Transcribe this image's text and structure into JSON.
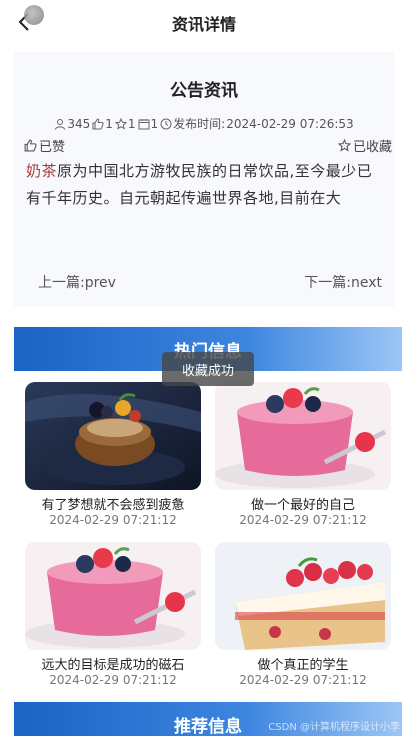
{
  "nav": {
    "title": "资讯详情",
    "back_icon": "chevron-left-icon"
  },
  "article": {
    "title": "公告资讯",
    "views": "345",
    "likes": "1",
    "collects": "1",
    "comments": "1",
    "publish_label": "发布时间:",
    "publish_time": "2024-02-29 07:26:53",
    "liked_label": "已赞",
    "collected_label": "已收藏",
    "content_highlight": "奶茶",
    "content_rest": "原为中国北方游牧民族的日常饮品,至今最少已有千年历史。自元朝起传遍世界各地,目前在大",
    "prev_label": "上一篇:",
    "prev_value": "prev",
    "next_label": "下一篇:",
    "next_value": "next"
  },
  "toast": "收藏成功",
  "hot": {
    "title": "热门信息",
    "items": [
      {
        "title": "有了梦想就不会感到疲惫",
        "date": "2024-02-29 07:21:12",
        "image": "cake-dark-plate"
      },
      {
        "title": "做一个最好的自己",
        "date": "2024-02-29 07:21:12",
        "image": "pink-pudding-berries"
      },
      {
        "title": "远大的目标是成功的磁石",
        "date": "2024-02-29 07:21:12",
        "image": "pink-pudding-berries"
      },
      {
        "title": "做个真正的学生",
        "date": "2024-02-29 07:21:12",
        "image": "raspberry-cake"
      }
    ]
  },
  "recommend": {
    "title": "推荐信息"
  },
  "watermark": "CSDN @计算机程序设计小李"
}
